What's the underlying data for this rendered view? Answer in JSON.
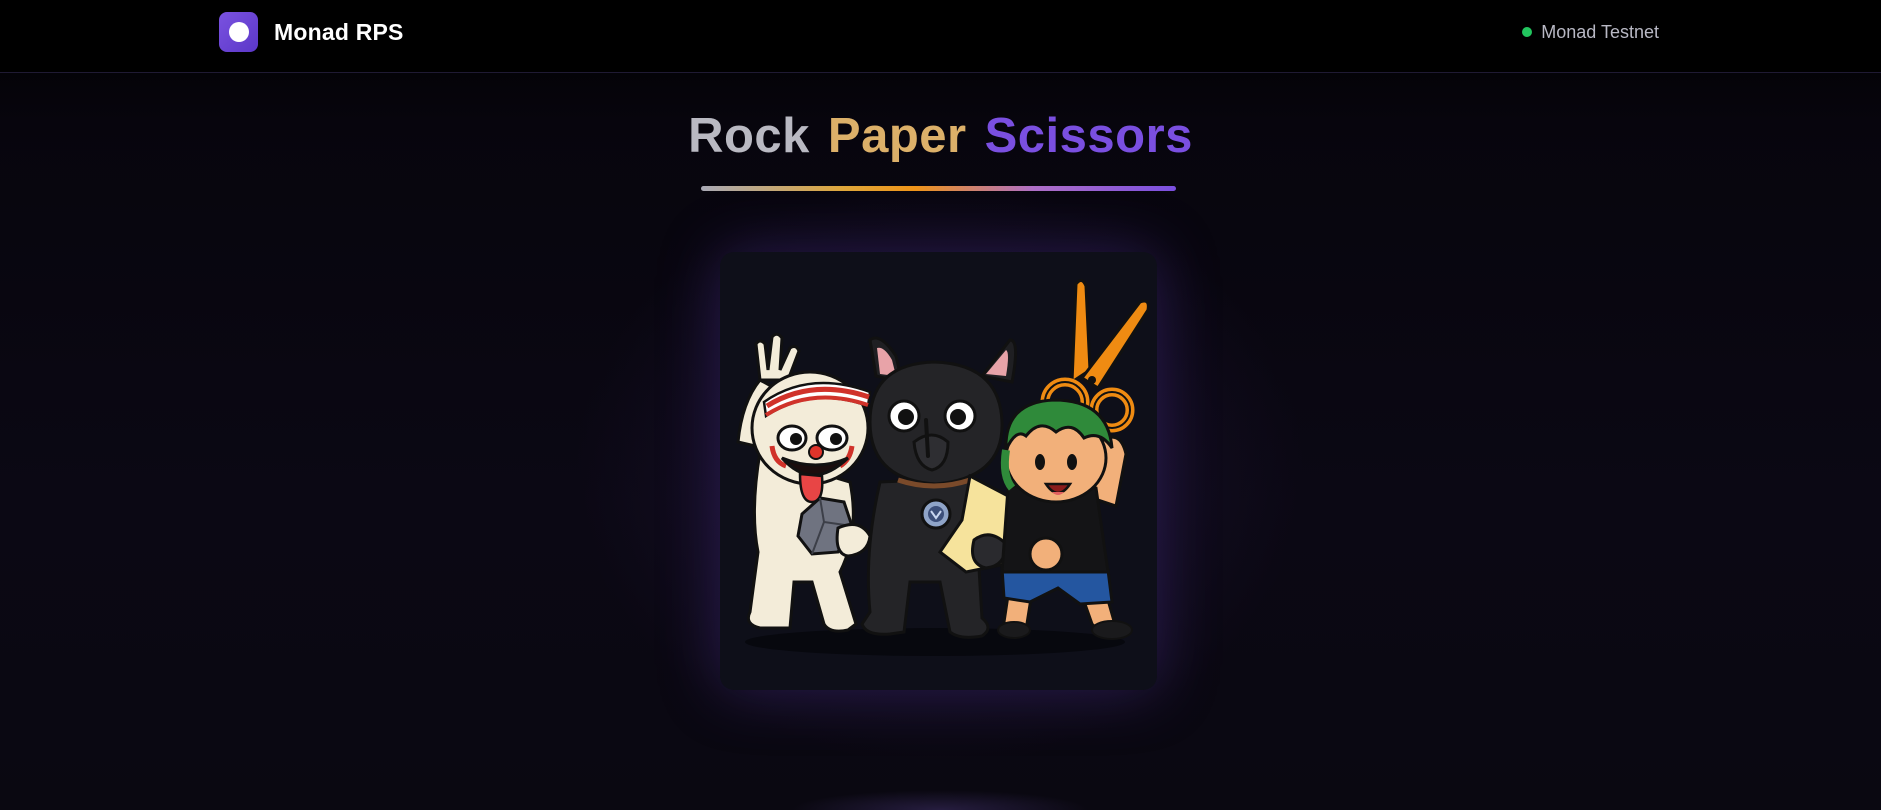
{
  "header": {
    "brand_name": "Monad RPS",
    "logo_icon": "monad-logo-icon",
    "network_label": "Monad Testnet",
    "network_status_color": "#22c55e"
  },
  "main": {
    "title_words": [
      "Rock",
      "Paper",
      "Scissors"
    ],
    "title_colors": [
      "#b9b9c2",
      "#dcb069",
      "#7a4fe0"
    ],
    "hero_image": "rock-paper-scissors-characters-illustration"
  },
  "colors": {
    "accent": "#6e45d9",
    "background": "#000000"
  }
}
